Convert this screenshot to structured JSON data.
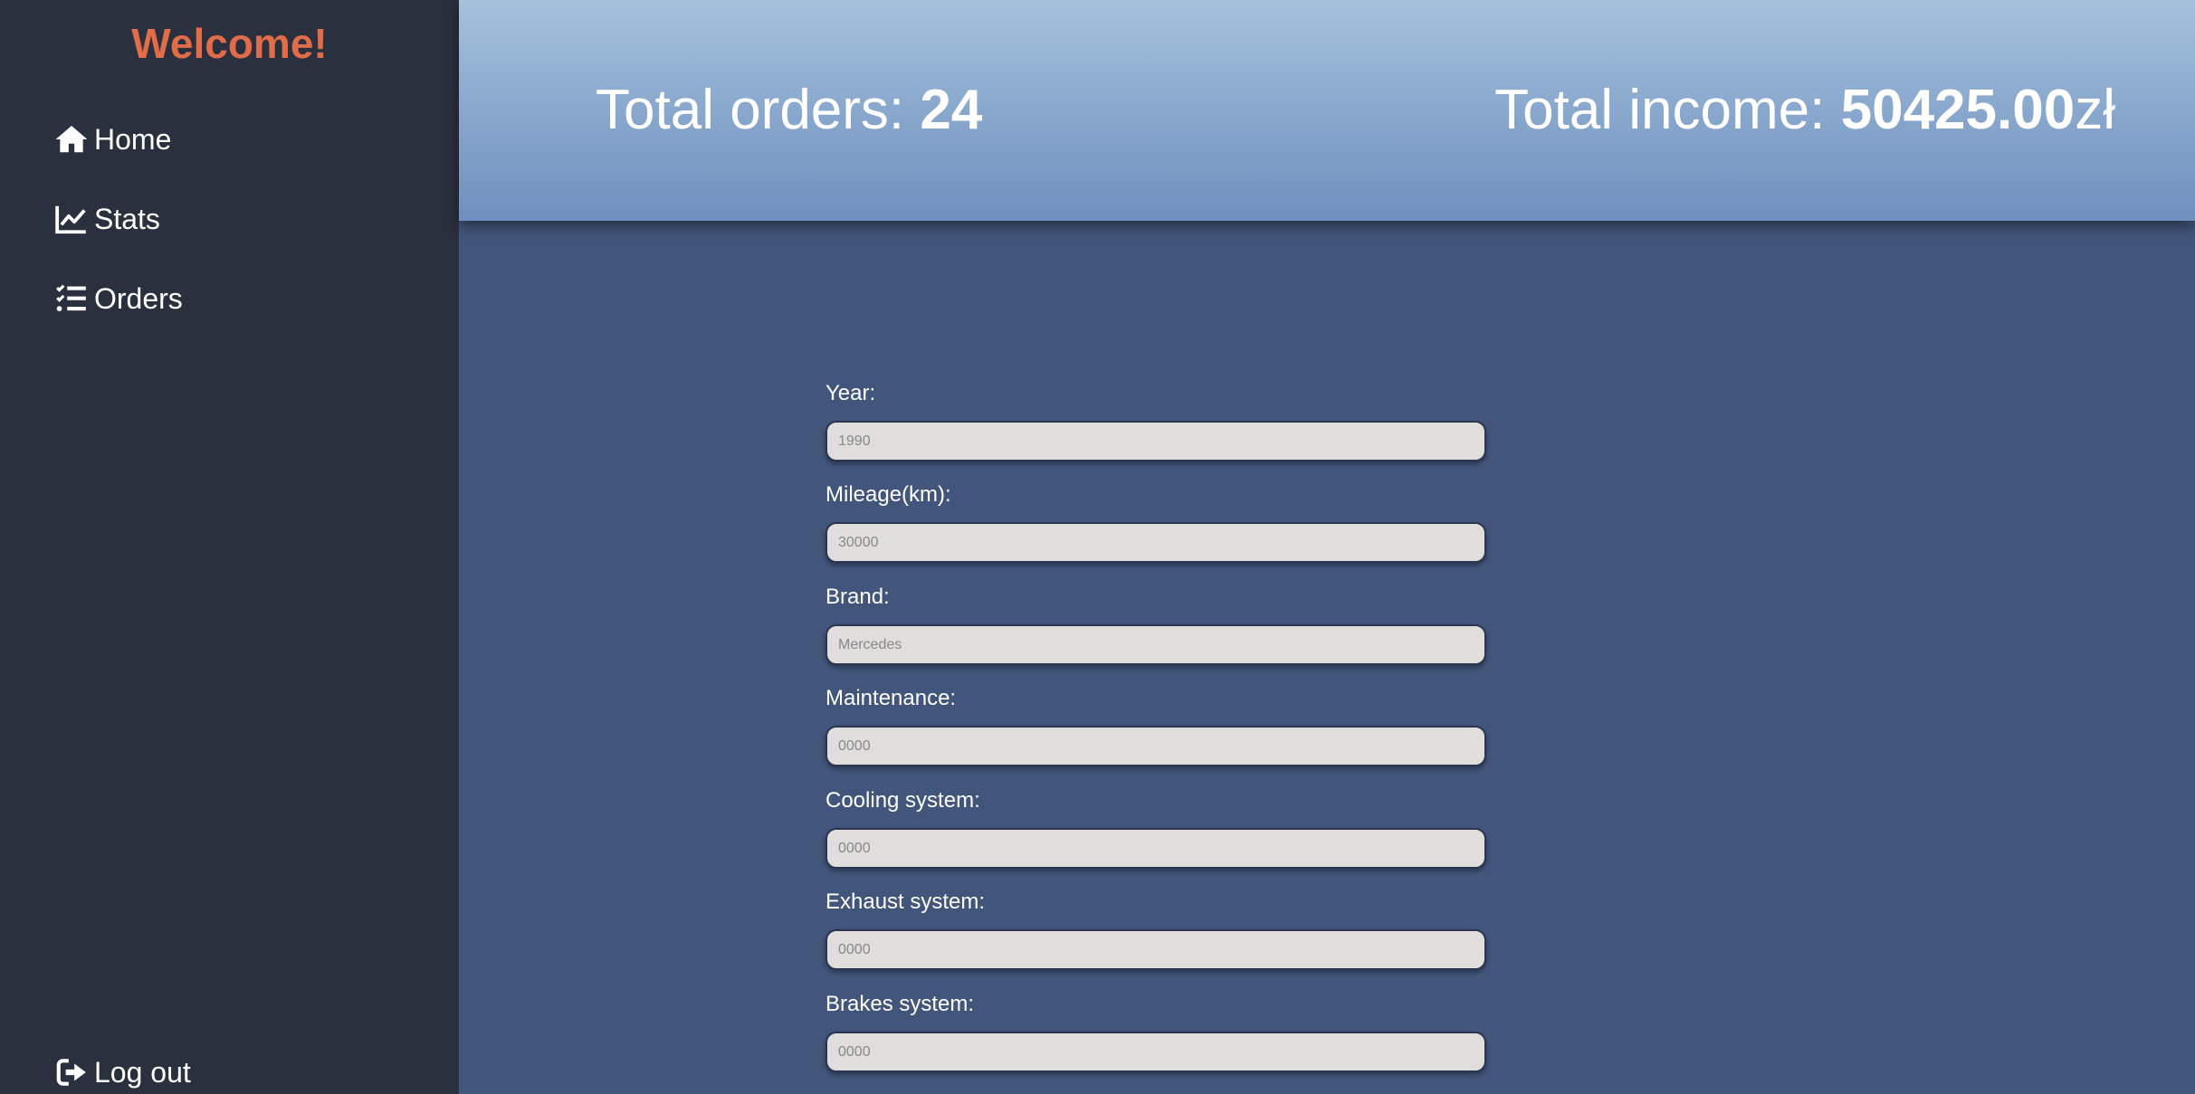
{
  "sidebar": {
    "welcome": "Welcome!",
    "nav": [
      {
        "label": "Home",
        "icon": "home-icon"
      },
      {
        "label": "Stats",
        "icon": "chart-line-icon"
      },
      {
        "label": "Orders",
        "icon": "list-check-icon"
      }
    ],
    "logout": {
      "label": "Log out",
      "icon": "sign-out-icon"
    }
  },
  "header": {
    "orders_label": "Total orders: ",
    "orders_value": "24",
    "income_label": "Total income: ",
    "income_value": "50425.00",
    "income_currency": "zł"
  },
  "form": {
    "fields": [
      {
        "label": "Year:",
        "placeholder": "1990"
      },
      {
        "label": "Mileage(km):",
        "placeholder": "30000"
      },
      {
        "label": "Brand:",
        "placeholder": "Mercedes"
      },
      {
        "label": "Maintenance:",
        "placeholder": "0000"
      },
      {
        "label": "Cooling system:",
        "placeholder": "0000"
      },
      {
        "label": "Exhaust system:",
        "placeholder": "0000"
      },
      {
        "label": "Brakes system:",
        "placeholder": "0000"
      }
    ]
  },
  "colors": {
    "sidebar_bg": "#2b303e",
    "welcome": "#e06c4a",
    "main_bg": "#42567b",
    "header_top": "#a4c1dc",
    "header_bottom": "#6f8fbe",
    "input_bg": "#e0dedd"
  }
}
